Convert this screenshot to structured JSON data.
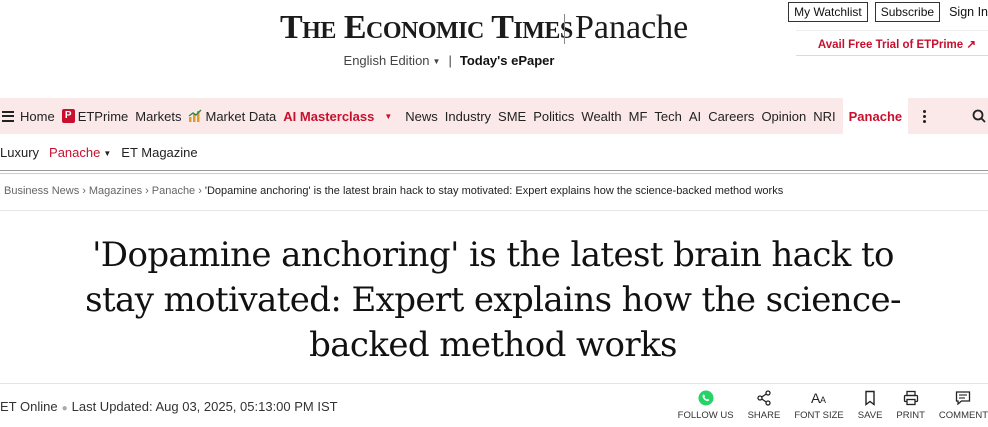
{
  "header": {
    "logo_main": "The Economic Times",
    "logo_section": "Panache",
    "edition": "English Edition",
    "edition_separator": "|",
    "epaper": "Today's ePaper",
    "watchlist": "My Watchlist",
    "subscribe": "Subscribe",
    "signin": "Sign In",
    "trial": "Avail Free Trial of ETPrime ↗"
  },
  "nav": {
    "home": "Home",
    "etprime": "ETPrime",
    "markets": "Markets",
    "marketdata": "Market Data",
    "aimasterclass": "AI Masterclass",
    "news": "News",
    "industry": "Industry",
    "sme": "SME",
    "politics": "Politics",
    "wealth": "Wealth",
    "mf": "MF",
    "tech": "Tech",
    "ai": "AI",
    "careers": "Careers",
    "opinion": "Opinion",
    "nri": "NRI",
    "panache": "Panache"
  },
  "subnav": {
    "luxury": "Luxury",
    "panache": "Panache",
    "etmagazine": "ET Magazine"
  },
  "breadcrumb": {
    "items": [
      "Business News",
      "Magazines",
      "Panache"
    ],
    "separator": "›",
    "current": "'Dopamine anchoring' is the latest brain hack to stay motivated: Expert explains how the science-backed method works"
  },
  "article": {
    "headline": "'Dopamine anchoring' is the latest brain hack to stay motivated: Expert explains how the science-backed method works",
    "author": "ET Online",
    "updated": "Last Updated: Aug 03, 2025, 05:13:00 PM IST"
  },
  "actions": {
    "follow": "FOLLOW US",
    "share": "SHARE",
    "fontsize": "FONT SIZE",
    "save": "SAVE",
    "print": "PRINT",
    "comment": "COMMENT"
  },
  "colors": {
    "accent": "#c8102e",
    "nav_bg": "#fbe8e8",
    "whatsapp": "#25d366"
  },
  "icons": [
    "hamburger-icon",
    "etprime-icon",
    "market-data-icon",
    "chevron-down-icon",
    "more-icon",
    "search-icon",
    "whatsapp-icon",
    "share-icon",
    "font-size-icon",
    "bookmark-icon",
    "print-icon",
    "comment-icon"
  ]
}
